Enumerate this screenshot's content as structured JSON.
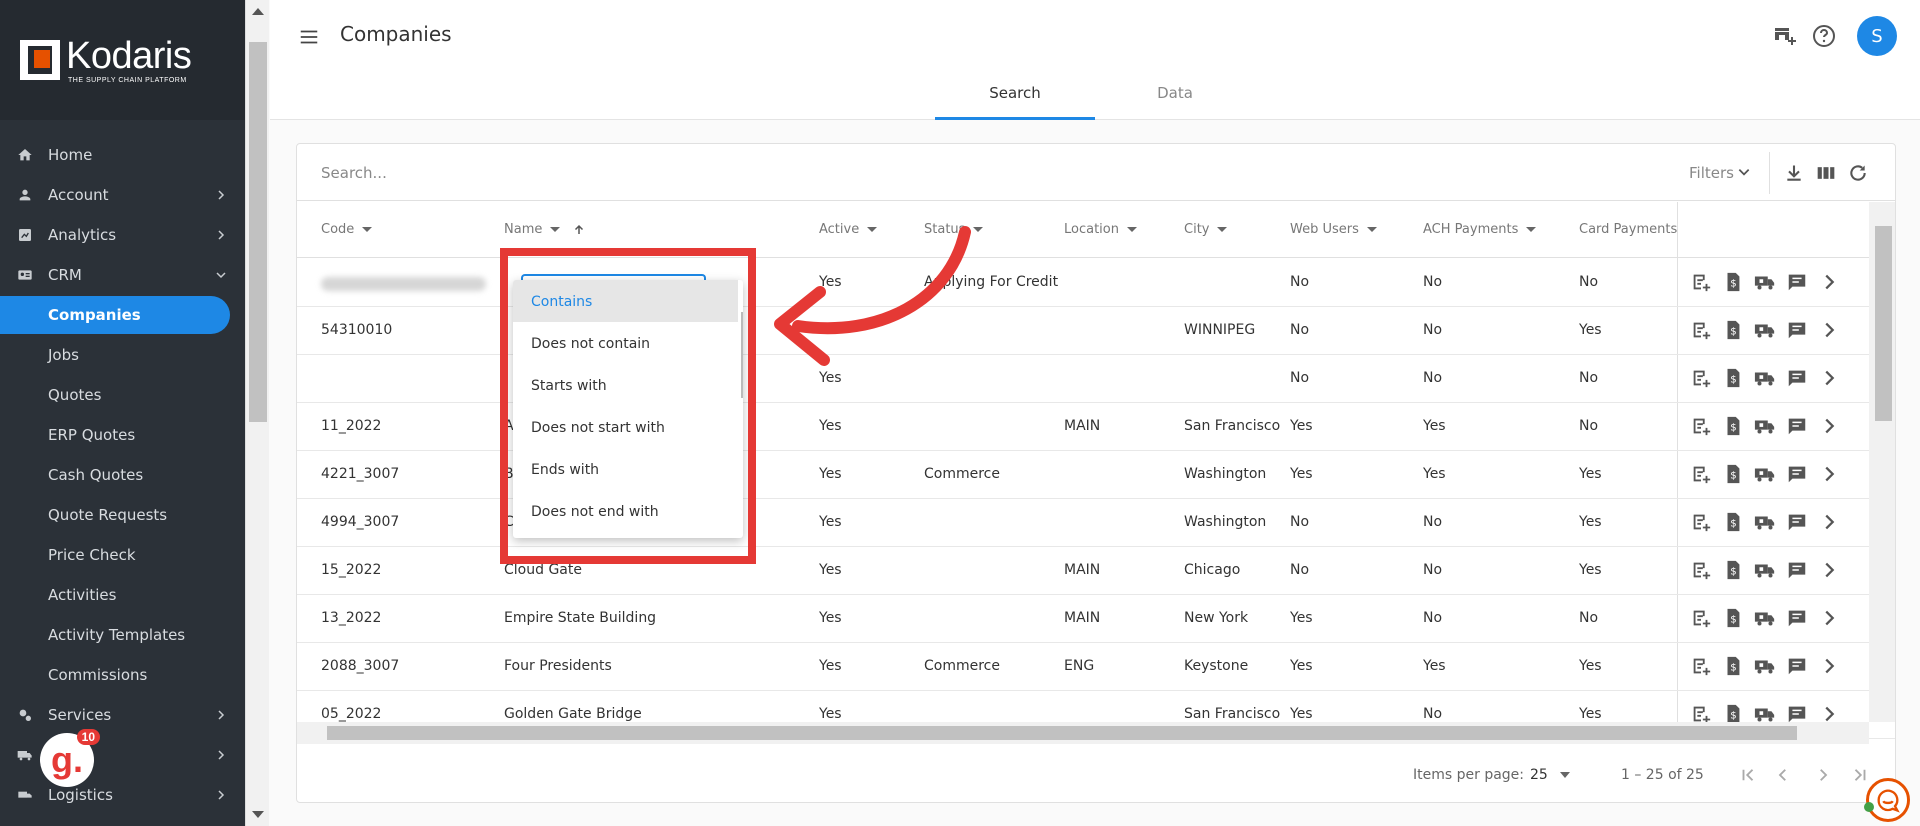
{
  "app": {
    "brand": "Kodaris",
    "tagline": "THE SUPPLY CHAIN PLATFORM"
  },
  "sidebar": {
    "items": [
      {
        "label": "Home",
        "icon": "home-icon"
      },
      {
        "label": "Account",
        "icon": "person-icon"
      },
      {
        "label": "Analytics",
        "icon": "chart-icon"
      },
      {
        "label": "CRM",
        "icon": "crm-icon"
      },
      {
        "label": "Companies"
      },
      {
        "label": "Jobs"
      },
      {
        "label": "Quotes"
      },
      {
        "label": "ERP Quotes"
      },
      {
        "label": "Cash Quotes"
      },
      {
        "label": "Quote Requests"
      },
      {
        "label": "Price Check"
      },
      {
        "label": "Activities"
      },
      {
        "label": "Activity Templates"
      },
      {
        "label": "Commissions"
      },
      {
        "label": "Services",
        "icon": "services-icon"
      },
      {
        "label": "",
        "icon": "truck-icon"
      },
      {
        "label": "Logistics",
        "icon": "logistics-icon"
      }
    ],
    "badge": {
      "letter": "g.",
      "count": "10"
    }
  },
  "header": {
    "title": "Companies",
    "avatar": "S"
  },
  "tabs": [
    {
      "label": "Search"
    },
    {
      "label": "Data"
    }
  ],
  "search": {
    "placeholder": "Search...",
    "filters": "Filters"
  },
  "table": {
    "columns": [
      "Code",
      "Name",
      "Active",
      "Status",
      "Location",
      "City",
      "Web Users",
      "ACH Payments",
      "Card Payments"
    ],
    "rows": [
      {
        "code": "",
        "name": "",
        "active": "Yes",
        "status": "Applying For Credit",
        "location": "",
        "city": "",
        "web": "No",
        "ach": "No",
        "card": "No",
        "blurred": true
      },
      {
        "code": "54310010",
        "name": "",
        "active": "",
        "status": "",
        "location": "",
        "city": "WINNIPEG",
        "web": "No",
        "ach": "No",
        "card": "Yes"
      },
      {
        "code": "",
        "name": "",
        "active": "Yes",
        "status": "",
        "location": "",
        "city": "",
        "web": "No",
        "ach": "No",
        "card": "No"
      },
      {
        "code": "11_2022",
        "name": "A",
        "active": "Yes",
        "status": "",
        "location": "MAIN",
        "city": "San Francisco",
        "web": "Yes",
        "ach": "Yes",
        "card": "No"
      },
      {
        "code": "4221_3007",
        "name": "B",
        "active": "Yes",
        "status": "Commerce",
        "location": "",
        "city": "Washington",
        "web": "Yes",
        "ach": "Yes",
        "card": "Yes"
      },
      {
        "code": "4994_3007",
        "name": "C",
        "active": "Yes",
        "status": "",
        "location": "",
        "city": "Washington",
        "web": "No",
        "ach": "No",
        "card": "Yes"
      },
      {
        "code": "15_2022",
        "name": "Cloud Gate",
        "active": "Yes",
        "status": "",
        "location": "MAIN",
        "city": "Chicago",
        "web": "No",
        "ach": "No",
        "card": "Yes"
      },
      {
        "code": "13_2022",
        "name": "Empire State Building",
        "active": "Yes",
        "status": "",
        "location": "MAIN",
        "city": "New York",
        "web": "Yes",
        "ach": "No",
        "card": "No"
      },
      {
        "code": "2088_3007",
        "name": "Four Presidents",
        "active": "Yes",
        "status": "Commerce",
        "location": "ENG",
        "city": "Keystone",
        "web": "Yes",
        "ach": "Yes",
        "card": "Yes"
      },
      {
        "code": "05_2022",
        "name": "Golden Gate Bridge",
        "active": "Yes",
        "status": "",
        "location": "",
        "city": "San Francisco",
        "web": "Yes",
        "ach": "No",
        "card": "Yes"
      }
    ]
  },
  "paginator": {
    "items_label": "Items per page:",
    "page_size": "25",
    "range": "1 – 25 of 25"
  },
  "dropdown": {
    "options": [
      "Contains",
      "Does not contain",
      "Starts with",
      "Does not start with",
      "Ends with",
      "Does not end with"
    ],
    "selected": "Contains"
  },
  "colors": {
    "accent": "#1e88e5",
    "highlight": "#e53935",
    "sidebar": "#2b3138"
  }
}
